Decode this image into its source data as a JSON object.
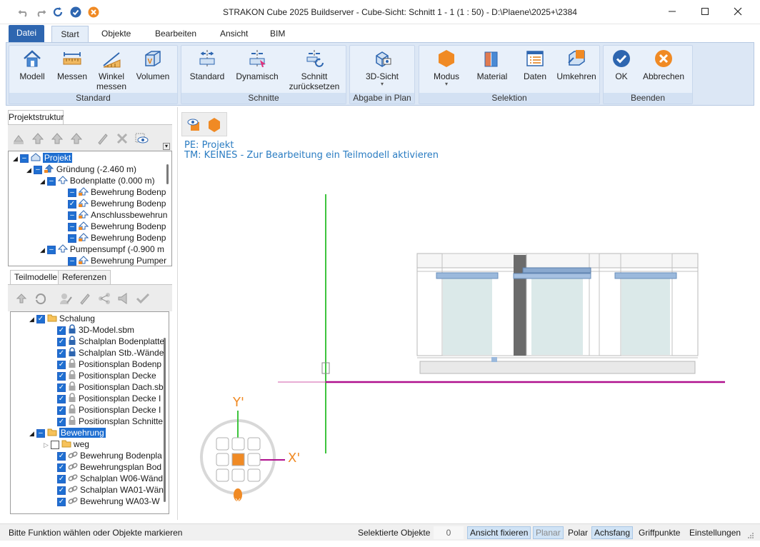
{
  "window": {
    "title": "STRAKON Cube 2025 Buildserver - Cube-Sicht: Schnitt  1 - 1 (1 : 50) - D:\\Plaene\\2025+\\2384"
  },
  "ribbon": {
    "tabs": [
      "Datei",
      "Start",
      "Objekte",
      "Bearbeiten",
      "Ansicht",
      "BIM"
    ],
    "groups": {
      "standard": {
        "label": "Standard",
        "buttons": [
          "Modell",
          "Messen",
          "Winkel messen",
          "Volumen"
        ]
      },
      "schnitte": {
        "label": "Schnitte",
        "buttons": [
          "Standard",
          "Dynamisch",
          "Schnitt zurücksetzen"
        ]
      },
      "abgabe": {
        "label": "Abgabe in Plan",
        "buttons": [
          "3D-Sicht"
        ]
      },
      "selektion": {
        "label": "Selektion",
        "buttons": [
          "Modus",
          "Material",
          "Daten",
          "Umkehren"
        ]
      },
      "beenden": {
        "label": "Beenden",
        "buttons": [
          "OK",
          "Abbrechen"
        ]
      }
    }
  },
  "projekt_panel": {
    "tab": "Projektstruktur",
    "tree": [
      "Projekt",
      "Gründung (-2.460 m)",
      "Bodenplatte (0.000 m)",
      "Bewehrung Bodenp",
      "Bewehrung Bodenp",
      "Anschlussbewehrun",
      "Bewehrung Bodenp",
      "Bewehrung Bodenp",
      "Pumpensumpf (-0.900 m",
      "Bewehrung Pumper"
    ]
  },
  "teilmodelle_panel": {
    "tabs": [
      "Teilmodelle",
      "Referenzen"
    ],
    "tree": [
      "Schalung",
      "3D-Model.sbm",
      "Schalplan Bodenplatte",
      "Schalplan Stb.-Wände",
      "Positionsplan Bodenp",
      "Positionsplan Decke",
      "Positionsplan Dach.sb",
      "Positionsplan Decke I",
      "Positionsplan Decke I",
      "Positionsplan Schnitte",
      "Bewehrung",
      "weg",
      "Bewehrung Bodenpla",
      "Bewehrungsplan Bod",
      "Schalplan W06-Wänd",
      "Schalplan WA01-Wän",
      "Bewehrung WA03-W"
    ]
  },
  "canvas": {
    "pe_line": "PE: Projekt",
    "tm_line": "TM: KEINES - Zur Bearbeitung ein Teilmodell aktivieren",
    "axis_y": "Y'",
    "axis_x": "X'"
  },
  "statusbar": {
    "message": "Bitte Funktion wählen oder Objekte markieren",
    "selected_label": "Selektierte Objekte",
    "selected_count": "0",
    "ansicht_fixieren": "Ansicht fixieren",
    "planar": "Planar",
    "polar": "Polar",
    "achsfang": "Achsfang",
    "griffpunkte": "Griffpunkte",
    "einstellungen": "Einstellungen"
  },
  "colors": {
    "accent": "#2e66b0",
    "ribbon_bg": "#dce7f5",
    "info_text": "#2a7cc2",
    "axis_green": "#3ec43e",
    "axis_magenta": "#b0108e",
    "orange": "#f08a24"
  }
}
